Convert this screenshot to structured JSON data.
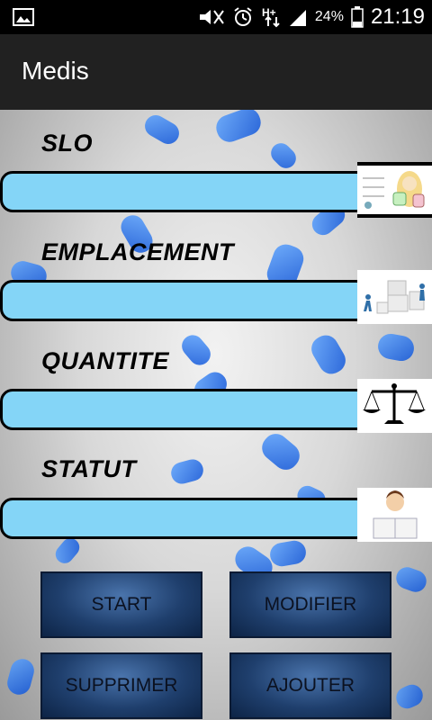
{
  "status_bar": {
    "battery_percent": "24%",
    "time": "21:19",
    "icons": [
      "image-icon",
      "muted-icon",
      "alarm-icon",
      "data-hplus-icon",
      "signal-icon",
      "battery-icon"
    ]
  },
  "app_bar": {
    "title": "Medis"
  },
  "fields": [
    {
      "label": "SLO",
      "value": "",
      "icon": "pharmacist-illustration"
    },
    {
      "label": "EMPLACEMENT",
      "value": "",
      "icon": "warehouse-workers-illustration"
    },
    {
      "label": "QUANTITE",
      "value": "",
      "icon": "scale-icon"
    },
    {
      "label": "STATUT",
      "value": "",
      "icon": "doctor-avatar-icon"
    }
  ],
  "buttons": {
    "start": "START",
    "modifier": "MODIFIER",
    "supprimer": "SUPPRIMER",
    "ajouter": "AJOUTER"
  },
  "colors": {
    "field_bg": "#84d5f7",
    "appbar_bg": "#212121",
    "button_bg": "#1f3f6d",
    "pill_blue": "#1e6bf0"
  }
}
